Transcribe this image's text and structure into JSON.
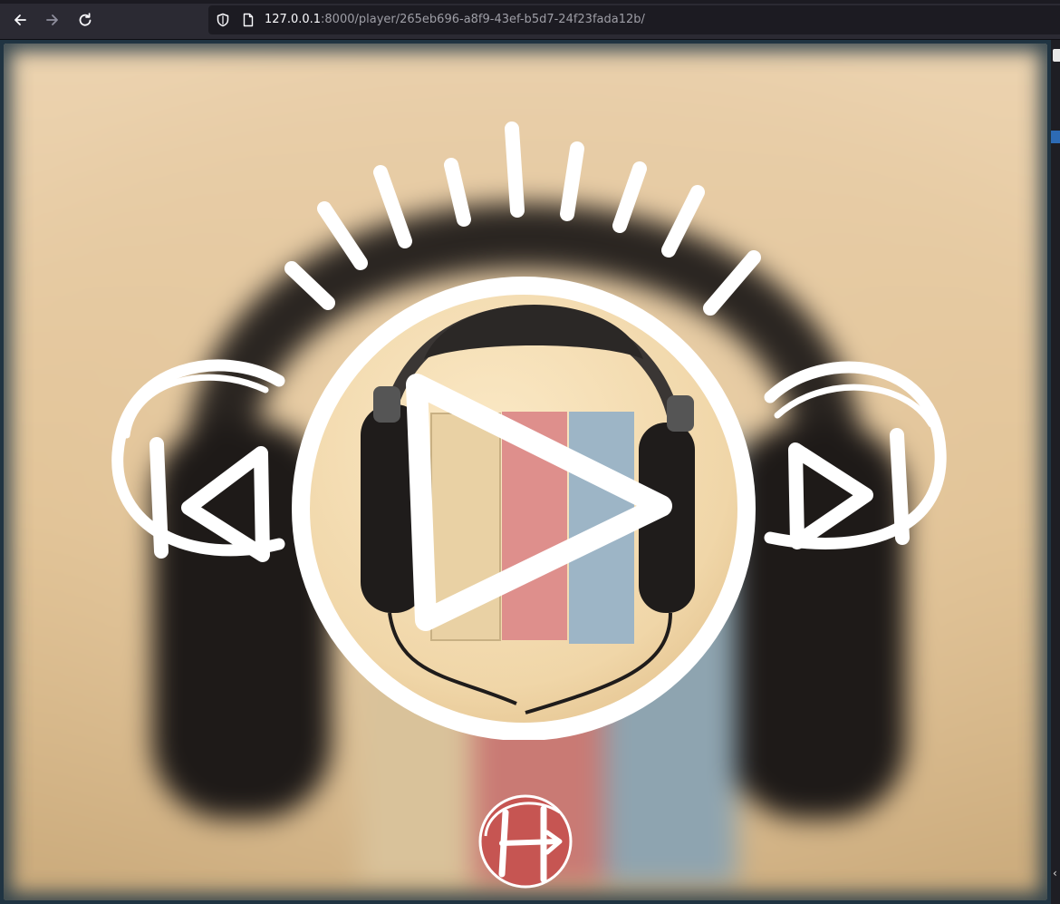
{
  "browser": {
    "back_icon": "arrow-left-icon",
    "forward_icon": "arrow-right-icon",
    "reload_icon": "reload-icon",
    "security_icon": "shield-icon",
    "page_icon": "page-icon",
    "url_host": "127.0.0.1",
    "url_rest": ":8000/player/265eb696-a8f9-43ef-b5d7-24f23fada12b/"
  },
  "player": {
    "cover_description_icon": "headphones-books-cover",
    "prev_icon": "skip-previous-icon",
    "play_icon": "play-icon",
    "next_icon": "skip-next-icon",
    "logo_icon": "brand-logo-icon",
    "colors": {
      "stroke": "#ffffff",
      "background_warm": "#e6c9a0",
      "logo_red": "#c65552"
    }
  }
}
